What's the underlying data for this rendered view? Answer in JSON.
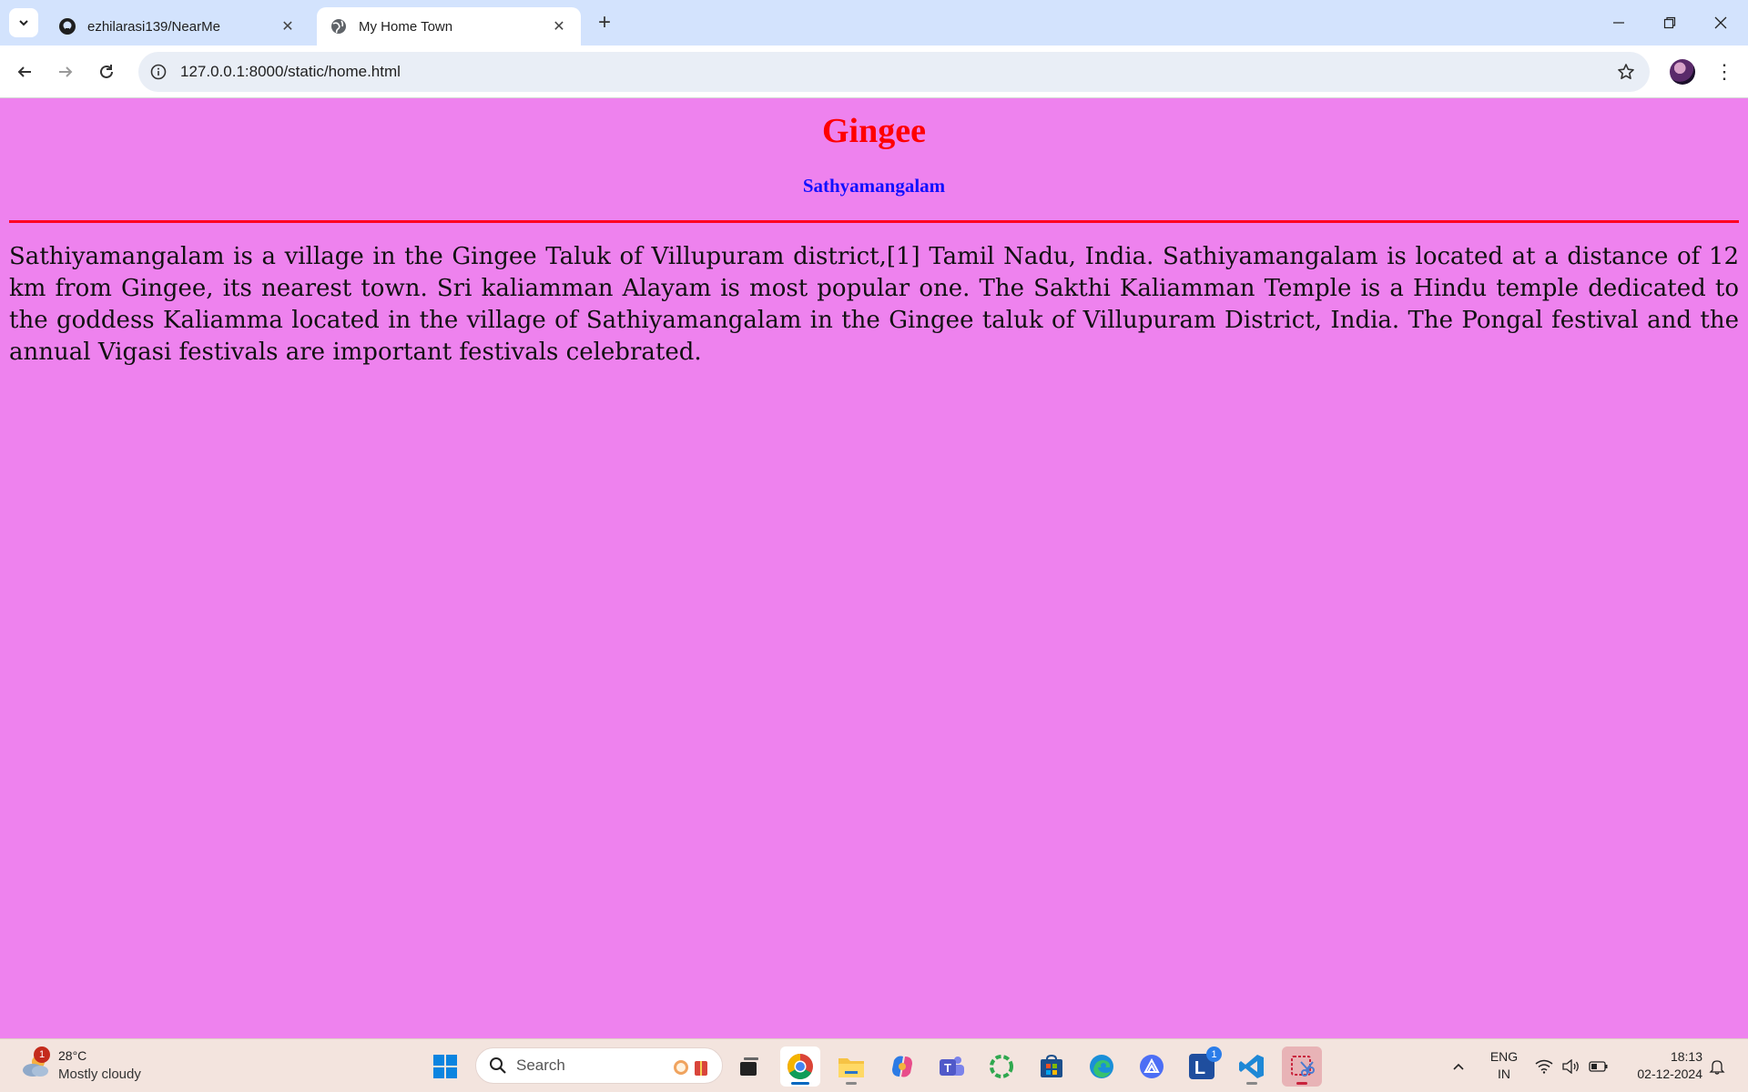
{
  "browser": {
    "tabs": [
      {
        "title": "ezhilarasi139/NearMe",
        "favicon": "github-icon",
        "active": false
      },
      {
        "title": "My Home Town",
        "favicon": "globe-icon",
        "active": true
      }
    ],
    "url": "127.0.0.1:8000/static/home.html"
  },
  "page": {
    "heading": "Gingee",
    "subheading": "Sathyamangalam",
    "paragraph": "Sathiyamangalam is a village in the Gingee Taluk of Villupuram district,[1] Tamil Nadu, India. Sathiyamangalam is located at a distance of 12 km from Gingee, its nearest town. Sri kaliamman Alayam is most popular one. The Sakthi Kaliamman Temple is a Hindu temple dedicated to the goddess Kaliamma located in the village of Sathiyamangalam in the Gingee taluk of Villupuram District, India. The Pongal festival and the annual Vigasi festivals are important festivals celebrated.",
    "colors": {
      "background": "#ee82ee",
      "heading": "#ff0000",
      "subheading": "#1010ff",
      "rule": "#ff0022"
    }
  },
  "taskbar": {
    "weather": {
      "temperature": "28°C",
      "condition": "Mostly cloudy",
      "badge": "1"
    },
    "search_label": "Search",
    "lang_primary": "ENG",
    "lang_secondary": "IN",
    "time": "18:13",
    "date": "02-12-2024",
    "l_badge": "1"
  }
}
